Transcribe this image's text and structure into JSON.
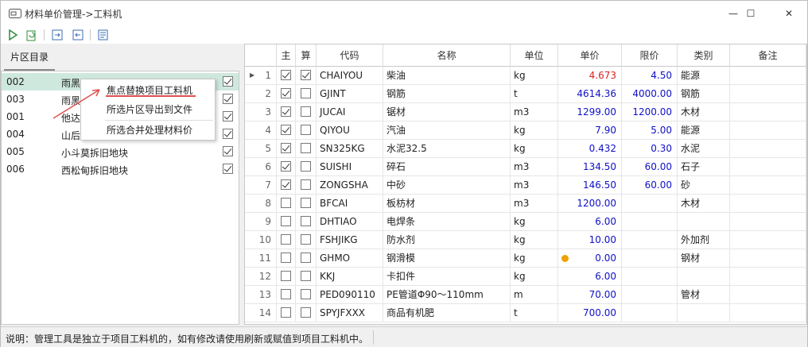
{
  "window": {
    "title": "材料单价管理->工料机",
    "minimize": "—",
    "maximize": "☐",
    "close": "✕"
  },
  "toolbar": {
    "icons": [
      "play-icon",
      "refresh-icon",
      "export-icon",
      "import-icon",
      "settings-icon"
    ]
  },
  "left_panel": {
    "tab": "片区目录",
    "items": [
      {
        "code": "002",
        "name": "雨黑",
        "checked": true,
        "selected": true
      },
      {
        "code": "003",
        "name": "雨黑",
        "checked": true,
        "selected": false
      },
      {
        "code": "001",
        "name": "他达",
        "checked": true,
        "selected": false
      },
      {
        "code": "004",
        "name": "山后",
        "checked": true,
        "selected": false
      },
      {
        "code": "005",
        "name": "小斗莫拆旧地块",
        "checked": true,
        "selected": false
      },
      {
        "code": "006",
        "name": "西松甸拆旧地块",
        "checked": true,
        "selected": false
      }
    ]
  },
  "context_menu": {
    "items": [
      "焦点替换项目工料机",
      "所选片区导出到文件",
      "所选合并处理材料价"
    ]
  },
  "grid": {
    "columns": [
      "",
      "主",
      "算",
      "代码",
      "名称",
      "单位",
      "单价",
      "限价",
      "类别",
      "备注"
    ],
    "rows": [
      {
        "no": "1",
        "main": true,
        "calc": true,
        "code": "CHAIYOU",
        "name": "柴油",
        "unit": "kg",
        "price": "4.673",
        "price_red": true,
        "limit": "4.50",
        "cat": "能源",
        "note": "",
        "current": true
      },
      {
        "no": "2",
        "main": true,
        "calc": false,
        "code": "GJINT",
        "name": "钢筋",
        "unit": "t",
        "price": "4614.36",
        "price_red": false,
        "limit": "4000.00",
        "cat": "钢筋",
        "note": ""
      },
      {
        "no": "3",
        "main": true,
        "calc": false,
        "code": "JUCAI",
        "name": "锯材",
        "unit": "m3",
        "price": "1299.00",
        "price_red": false,
        "limit": "1200.00",
        "cat": "木材",
        "note": ""
      },
      {
        "no": "4",
        "main": true,
        "calc": false,
        "code": "QIYOU",
        "name": "汽油",
        "unit": "kg",
        "price": "7.90",
        "price_red": false,
        "limit": "5.00",
        "cat": "能源",
        "note": ""
      },
      {
        "no": "5",
        "main": true,
        "calc": false,
        "code": "SN325KG",
        "name": "水泥32.5",
        "unit": "kg",
        "price": "0.432",
        "price_red": false,
        "limit": "0.30",
        "cat": "水泥",
        "note": ""
      },
      {
        "no": "6",
        "main": true,
        "calc": false,
        "code": "SUISHI",
        "name": "碎石",
        "unit": "m3",
        "price": "134.50",
        "price_red": false,
        "limit": "60.00",
        "cat": "石子",
        "note": ""
      },
      {
        "no": "7",
        "main": true,
        "calc": false,
        "code": "ZONGSHA",
        "name": "中砂",
        "unit": "m3",
        "price": "146.50",
        "price_red": false,
        "limit": "60.00",
        "cat": "砂",
        "note": ""
      },
      {
        "no": "8",
        "main": false,
        "calc": false,
        "code": "BFCAI",
        "name": "板枋材",
        "unit": "m3",
        "price": "1200.00",
        "price_red": false,
        "limit": "",
        "cat": "木材",
        "note": ""
      },
      {
        "no": "9",
        "main": false,
        "calc": false,
        "code": "DHTIAO",
        "name": "电焊条",
        "unit": "kg",
        "price": "6.00",
        "price_red": false,
        "limit": "",
        "cat": "",
        "note": ""
      },
      {
        "no": "10",
        "main": false,
        "calc": false,
        "code": "FSHJIKG",
        "name": "防水剂",
        "unit": "kg",
        "price": "10.00",
        "price_red": false,
        "limit": "",
        "cat": "外加剂",
        "note": ""
      },
      {
        "no": "11",
        "main": false,
        "calc": false,
        "code": "GHMO",
        "name": "钢滑模",
        "unit": "kg",
        "price": "0.00",
        "price_red": false,
        "limit": "",
        "cat": "钢材",
        "note": "",
        "dot": true
      },
      {
        "no": "12",
        "main": false,
        "calc": false,
        "code": "KKJ",
        "name": "卡扣件",
        "unit": "kg",
        "price": "6.00",
        "price_red": false,
        "limit": "",
        "cat": "",
        "note": ""
      },
      {
        "no": "13",
        "main": false,
        "calc": false,
        "code": "PED090110",
        "name": "PE管道Φ90～110mm",
        "unit": "m",
        "price": "70.00",
        "price_red": false,
        "limit": "",
        "cat": "管材",
        "note": ""
      },
      {
        "no": "14",
        "main": false,
        "calc": false,
        "code": "SPYJFXXX",
        "name": "商品有机肥",
        "unit": "t",
        "price": "700.00",
        "price_red": false,
        "limit": "",
        "cat": "",
        "note": ""
      }
    ]
  },
  "statusbar": {
    "text": "说明：管理工具是独立于项目工料机的，如有修改请使用刷新或赋值到项目工料机中。"
  },
  "colors": {
    "price_text": "#1010c8",
    "price_over": "#e02020",
    "selection": "#cfe8de",
    "dot": "#f0a000"
  }
}
